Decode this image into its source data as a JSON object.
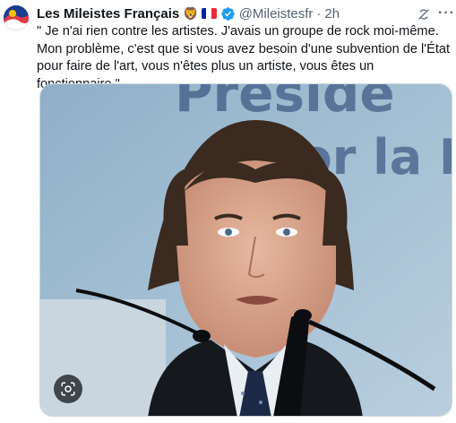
{
  "tweet": {
    "display_name": "Les Mileistes Français",
    "emoji": "🦁",
    "handle": "@Mileistesfr",
    "separator": "·",
    "time": "2h",
    "text": "\" Je n'ai rien contre les artistes. J'avais un groupe de rock moi-même. Mon problème, c'est que si vous avez besoin d'une subvention de l'État pour faire de l'art, vous n'êtes plus un artiste, vous êtes un fonctionnaire.\"",
    "background_sign_text": "Preside… por la L…"
  },
  "icons": {
    "verified": "verified-badge-icon",
    "grok": "grok-icon",
    "more": "more-options-icon",
    "lens": "visual-search-icon",
    "flag": "france-flag-icon"
  },
  "colors": {
    "text_primary": "#0f1419",
    "text_secondary": "#536471",
    "verified_blue": "#1d9bf0",
    "flag_blue": "#002395",
    "flag_red": "#ed2939"
  }
}
